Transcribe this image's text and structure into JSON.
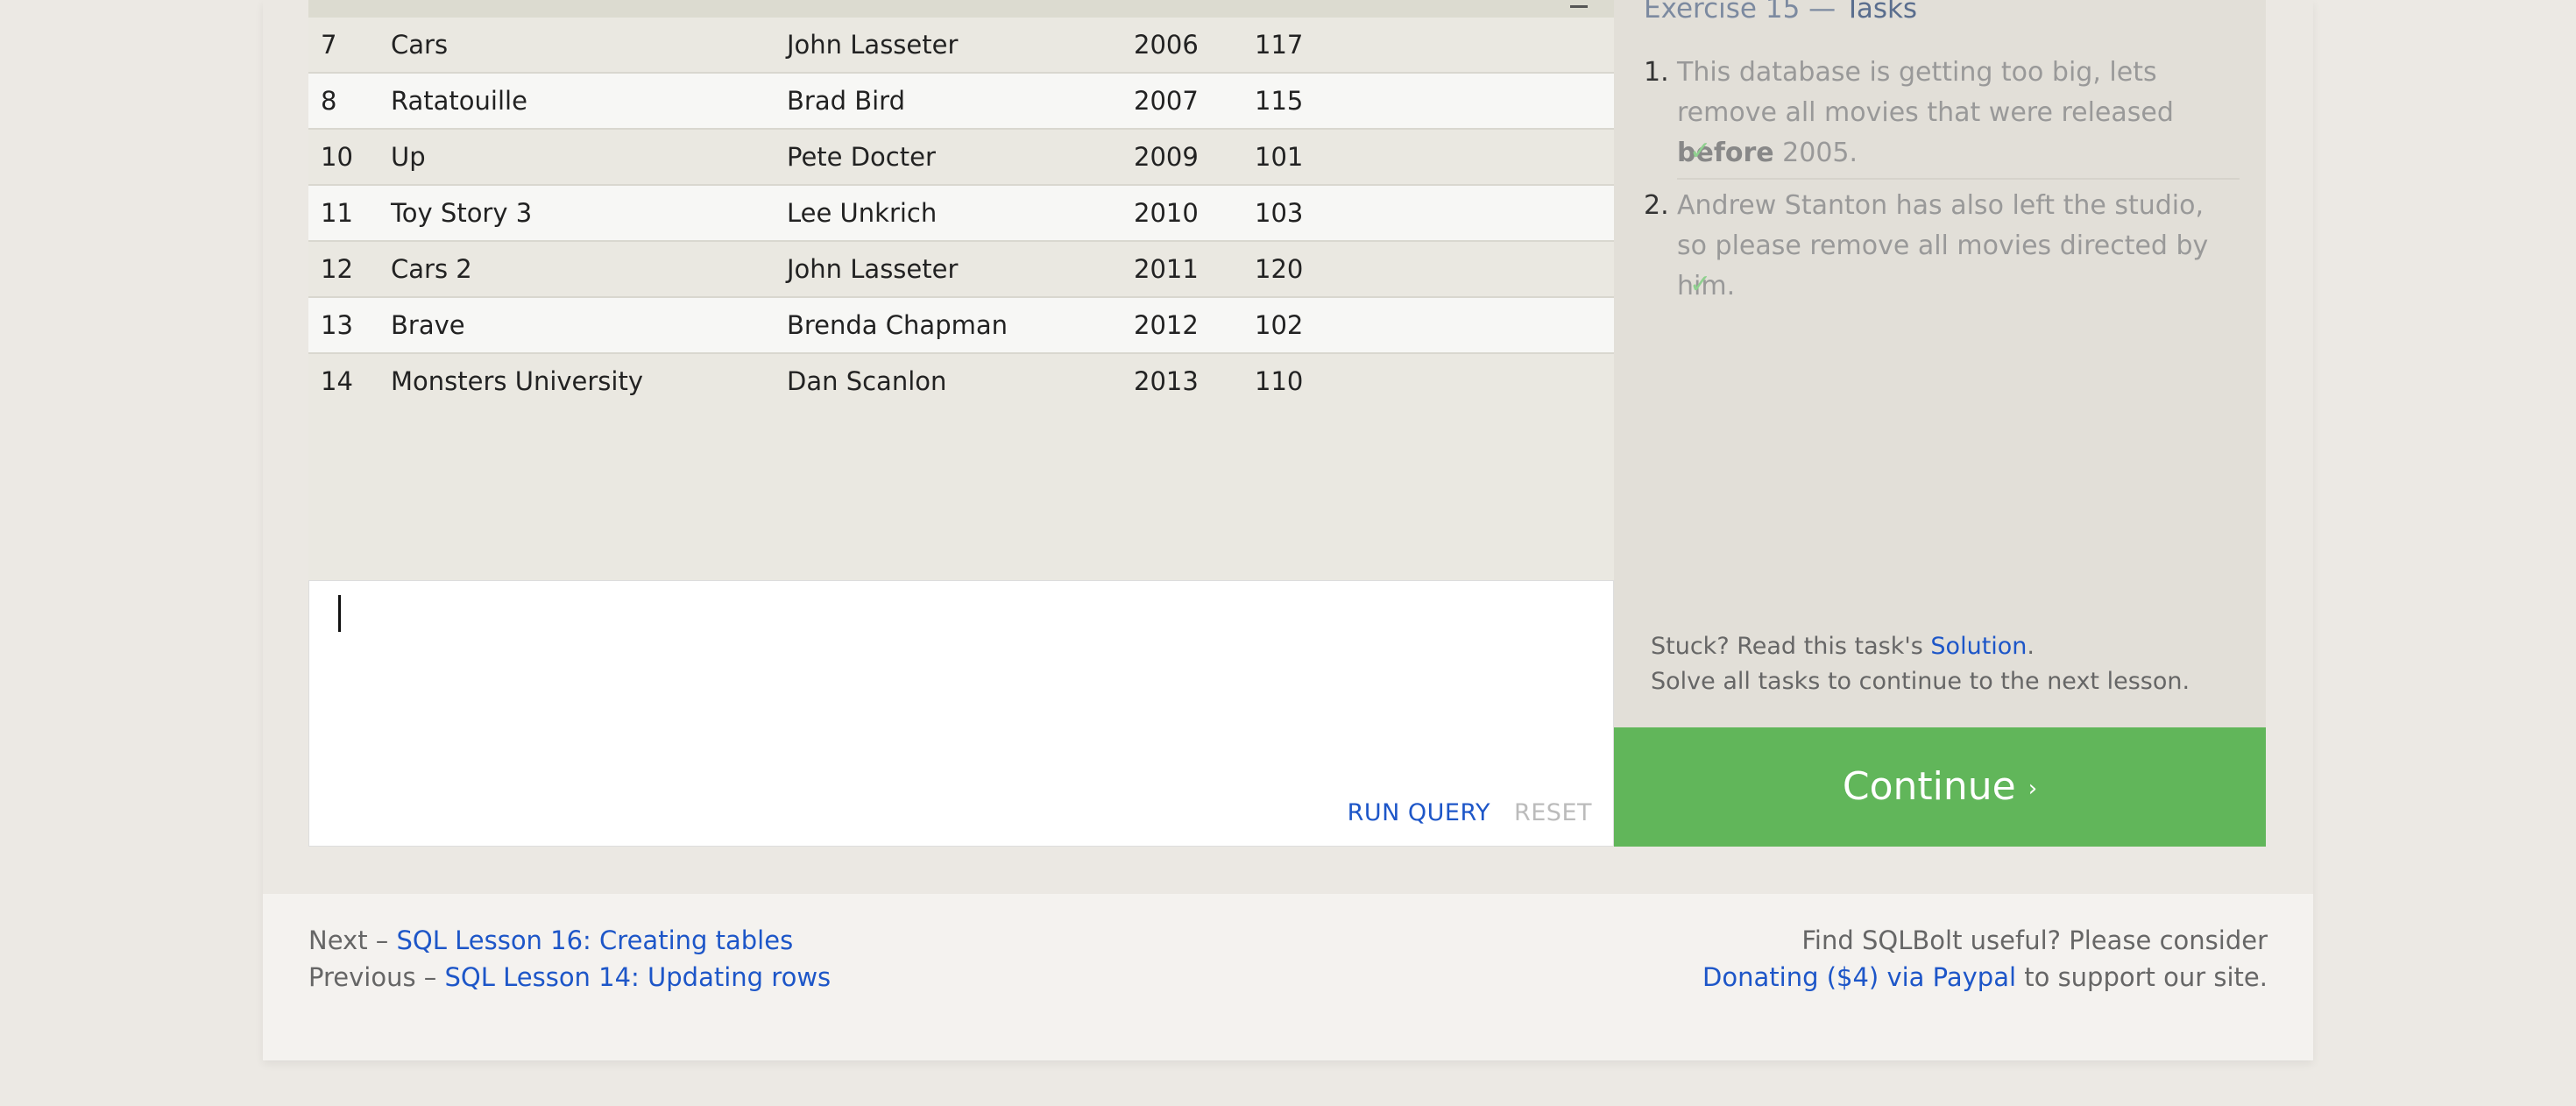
{
  "table": {
    "rows": [
      {
        "id": "7",
        "title": "Cars",
        "director": "John Lasseter",
        "year": "2006",
        "length": "117"
      },
      {
        "id": "8",
        "title": "Ratatouille",
        "director": "Brad Bird",
        "year": "2007",
        "length": "115"
      },
      {
        "id": "10",
        "title": "Up",
        "director": "Pete Docter",
        "year": "2009",
        "length": "101"
      },
      {
        "id": "11",
        "title": "Toy Story 3",
        "director": "Lee Unkrich",
        "year": "2010",
        "length": "103"
      },
      {
        "id": "12",
        "title": "Cars 2",
        "director": "John Lasseter",
        "year": "2011",
        "length": "120"
      },
      {
        "id": "13",
        "title": "Brave",
        "director": "Brenda Chapman",
        "year": "2012",
        "length": "102"
      },
      {
        "id": "14",
        "title": "Monsters University",
        "director": "Dan Scanlon",
        "year": "2013",
        "length": "110"
      }
    ]
  },
  "editor": {
    "value": "",
    "run_label": "RUN QUERY",
    "reset_label": "RESET"
  },
  "tasks": {
    "title_prefix": "Exercise 15 — ",
    "title_strong": "Tasks",
    "items": [
      {
        "num": "1.",
        "text_pre": "This database is getting too big, lets remove all movies that were released ",
        "text_bold": "before",
        "text_post": " 2005.",
        "check": "✓"
      },
      {
        "num": "2.",
        "text_pre": "Andrew Stanton has also left the studio, so please remove all movies directed by him.",
        "text_bold": "",
        "text_post": "",
        "check": "✓"
      }
    ],
    "help_pre": "Stuck? Read this task's ",
    "help_link": "Solution",
    "help_post": ".",
    "help_line2": "Solve all tasks to continue to the next lesson.",
    "continue_label": "Continue",
    "continue_icon": "›"
  },
  "footer": {
    "next_prefix": "Next – ",
    "next_link": "SQL Lesson 16: Creating tables",
    "prev_prefix": "Previous – ",
    "prev_link": "SQL Lesson 14: Updating rows",
    "support_line1": "Find SQLBolt useful? Please consider",
    "donate_link": "Donating ($4) via Paypal",
    "support_post": " to support our site."
  },
  "colors": {
    "accent_link": "#1d56c8",
    "continue_green": "#61b65a",
    "check_green": "#8fd08f"
  }
}
